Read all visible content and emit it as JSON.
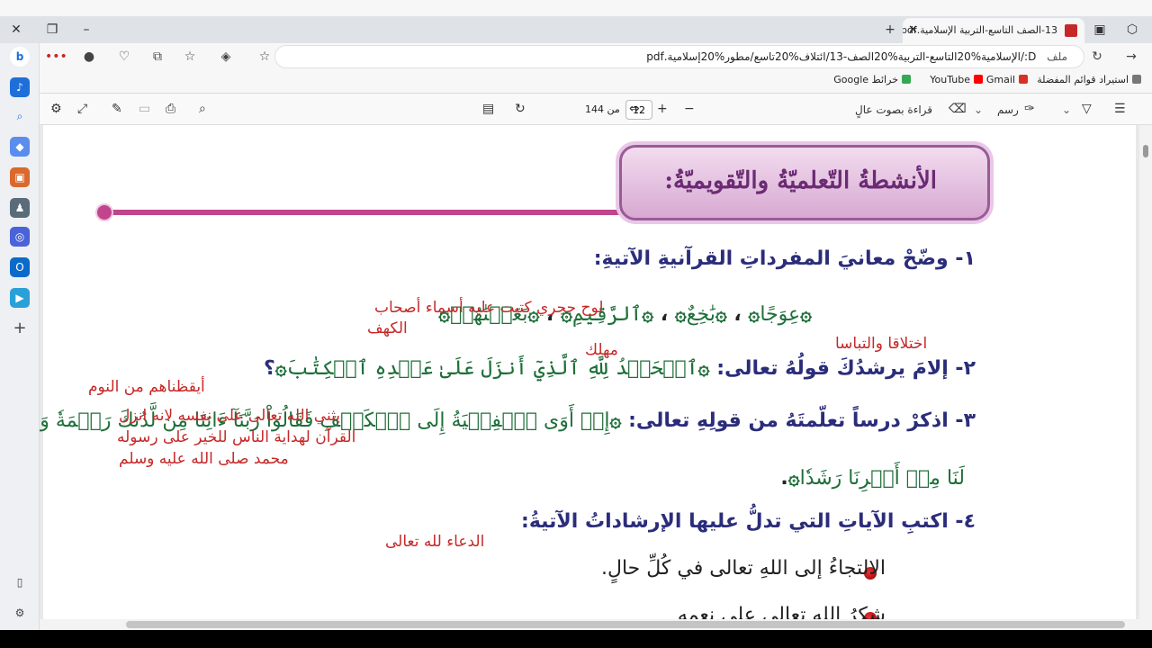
{
  "browser": {
    "tab_title": "13-الصف التاسع-التربية الإسلامية.pdf",
    "address": "D:/الإسلامية%20التاسع-التربية%20الصف-13/ائتلاف%20تاسع/مطور%20إسلامية.pdf",
    "address_label": "ملف",
    "favorites": [
      {
        "label": "استيراد قوائم المفضلة",
        "color": "#555555"
      },
      {
        "label": "Gmail",
        "color": "#d93025"
      },
      {
        "label": "YouTube",
        "color": "#ff0000"
      },
      {
        "label": "خرائط Google",
        "color": "#34a853"
      }
    ]
  },
  "pdf_toolbar": {
    "read_aloud": "قراءة بصوت عالٍ",
    "draw": "رسم",
    "page_current": "12",
    "page_of": "من 144"
  },
  "page": {
    "banner_title": "الأنشطةُ التّعلميّةُ والتّقويميّةُ:",
    "q1": {
      "num": "١-",
      "text": "وضّحْ معانيَ المفرداتِ القرآنيةِ الآتيةِ:"
    },
    "q1_words": [
      "عِوَجًا",
      "بَٰخِعٌ",
      "ٱلرَّقِيمِ",
      "بَعَثۡنَٰهُمۡ"
    ],
    "q2": {
      "num": "٢-",
      "text": "إلامَ يرشدُكَ قولُهُ تعالى:",
      "verse": "ٱلۡحَمۡدُ لِلَّهِ ٱلَّذِيٓ أَنزَلَ عَلَىٰ عَبۡدِهِ ٱلۡكِتَٰبَ",
      "tail": "؟"
    },
    "q3": {
      "num": "٣-",
      "text": "اذكرْ درساً تعلّمتَهُ من قولِهِ تعالى:",
      "verse": "إِذۡ أَوَى ٱلۡفِتۡيَةُ إِلَى ٱلۡكَهۡفِ فَقَالُواْ رَبَّنَآ ءَاتِنَا مِن لَّدُنكَ رَحۡمَةٗ وَهَيِّئۡ",
      "verse2": "لَنَا مِنۡ أَمۡرِنَا رَشَدٗا"
    },
    "q4": {
      "num": "٤-",
      "text": "اكتبِ الآياتِ التي تدلُّ عليها الإرشاداتُ الآتيةُ:"
    },
    "q4_items": [
      "الالتجاءُ إلى اللهِ تعالى في كُلِّ حالٍ.",
      "شكرُ اللهِ تعالى على نعمه"
    ]
  },
  "annotations": {
    "n1": "لوح حجري كتبت عليه أسماء أصحاب",
    "n1b": "الكهف",
    "n2": "اختلاقا والتباسا",
    "n3": "مهلك",
    "n4": "أيقظناهم من النوم",
    "n5": "يثني الله تعالى على نفسه لانه انزل",
    "n5b": "القرآن لهداية الناس للخير على رسوله",
    "n5c": "محمد صلى الله عليه وسلم",
    "n6": "الدعاء لله تعالى"
  }
}
